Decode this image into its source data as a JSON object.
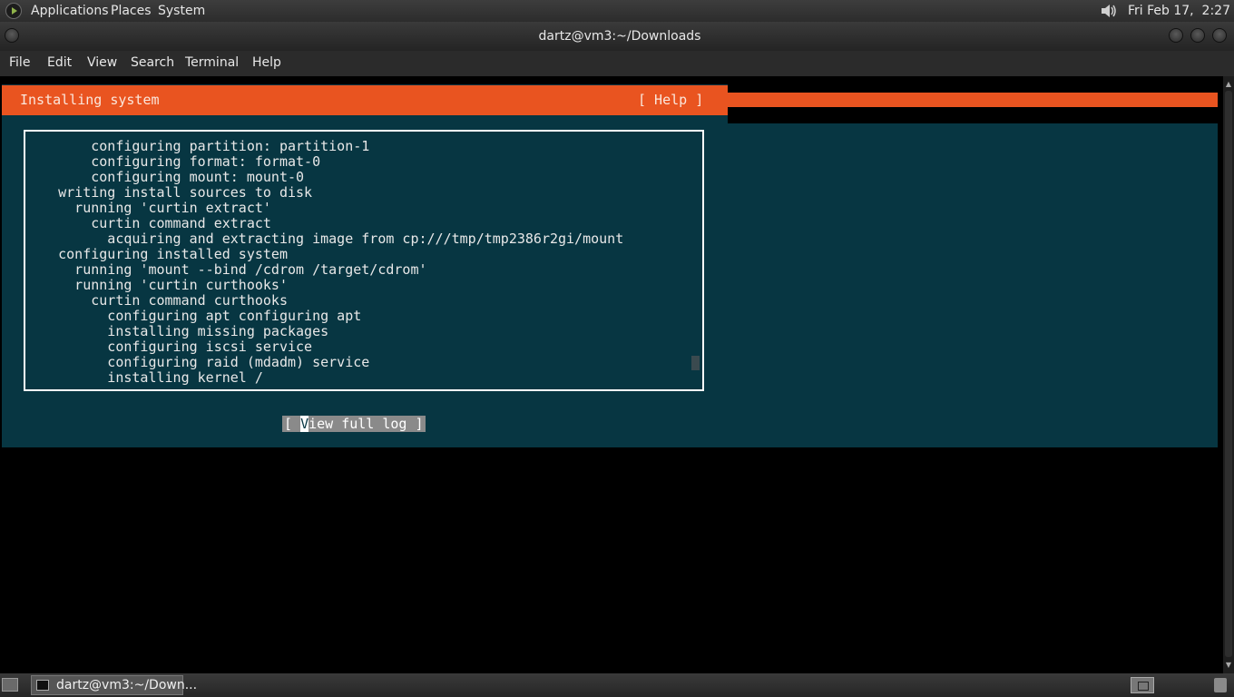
{
  "top_panel": {
    "menus": [
      "Applications",
      "Places",
      "System"
    ],
    "clock": "Fri Feb 17,  2:27 AM",
    "icons": [
      "app-logo-icon",
      "volume-icon"
    ]
  },
  "window": {
    "title": "dartz@vm3:~/Downloads",
    "menubar": [
      "File",
      "Edit",
      "View",
      "Search",
      "Terminal",
      "Help"
    ]
  },
  "installer": {
    "header_title": "Installing system",
    "help_button": "[ Help ]",
    "log_lines": [
      "        configuring partition: partition-1",
      "        configuring format: format-0",
      "        configuring mount: mount-0",
      "    writing install sources to disk",
      "      running 'curtin extract'",
      "        curtin command extract",
      "          acquiring and extracting image from cp:///tmp/tmp2386r2gi/mount",
      "    configuring installed system",
      "      running 'mount --bind /cdrom /target/cdrom'",
      "      running 'curtin curthooks'",
      "        curtin command curthooks",
      "          configuring apt configuring apt",
      "          installing missing packages",
      "          configuring iscsi service",
      "          configuring raid (mdadm) service",
      "          installing kernel /"
    ],
    "view_log_button": {
      "open": "[ ",
      "cursor_char": "V",
      "rest": "iew full log ]"
    },
    "colors": {
      "header": "#e95420",
      "background": "#073642"
    }
  },
  "taskbar": {
    "item_label": "dartz@vm3:~/Down...",
    "icons": [
      "show-desktop-icon",
      "terminal-icon",
      "workspace-switcher-icon",
      "trash-icon"
    ]
  }
}
